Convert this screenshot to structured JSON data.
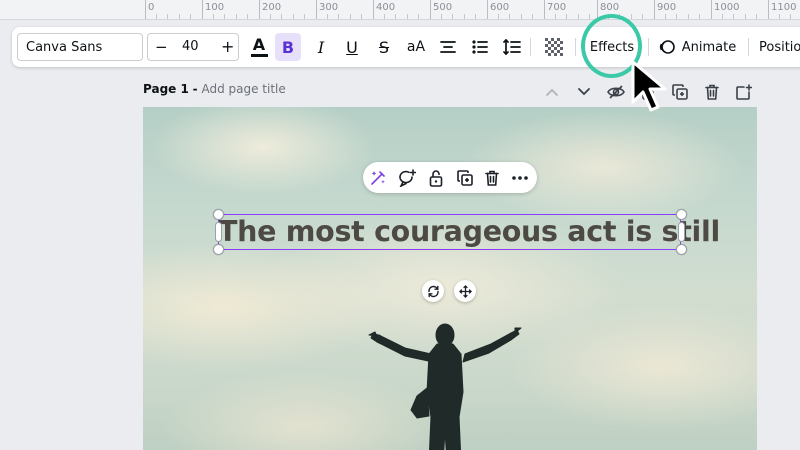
{
  "ruler": {
    "labels": [
      "0",
      "100",
      "200",
      "300",
      "400",
      "500",
      "600",
      "700",
      "800",
      "900",
      "1000",
      "1100"
    ]
  },
  "toolbar": {
    "font_name": "Canva Sans",
    "font_size": "40",
    "minus": "−",
    "plus": "+",
    "color_glyph": "A",
    "text_color": "#0d1216",
    "bold": "B",
    "italic": "I",
    "underline": "U",
    "strikethrough": "S",
    "case": "aA",
    "effects": "Effects",
    "animate": "Animate",
    "position": "Positio"
  },
  "page": {
    "label": "Page 1",
    "separator": "-",
    "title_placeholder": "Add page title"
  },
  "canvas": {
    "text": "The most courageous act is still"
  },
  "colors": {
    "selection": "#8b3dff",
    "highlight": "#3cc9a8",
    "bold_active_bg": "#e7e0fb",
    "bold_active_fg": "#5a32d4"
  }
}
